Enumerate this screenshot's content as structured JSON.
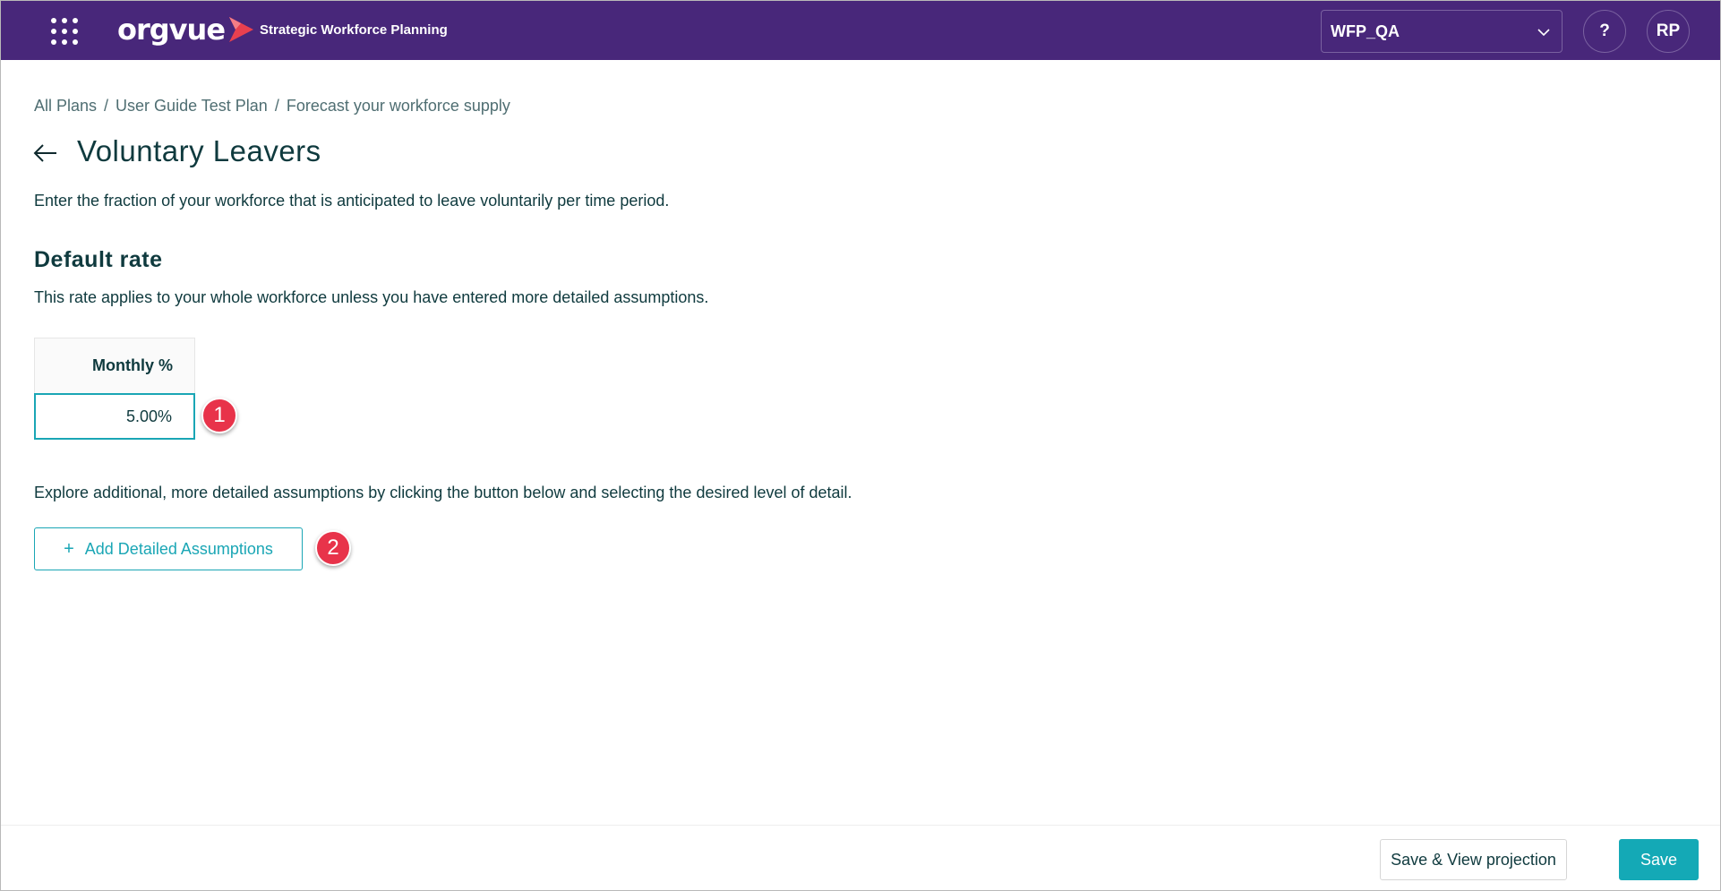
{
  "header": {
    "logo_text": "orgvue",
    "product_name": "Strategic Workforce Planning",
    "tenant_value": "WFP_QA",
    "help_label": "?",
    "avatar_initials": "RP",
    "brand_color": "#48277a",
    "logo_accent_color": "#e8404f"
  },
  "breadcrumb": {
    "items": [
      "All Plans",
      "User Guide Test Plan",
      "Forecast your workforce supply"
    ],
    "separator": "/"
  },
  "page": {
    "title": "Voluntary Leavers",
    "description": "Enter the fraction of your workforce that is anticipated to leave voluntarily per time period."
  },
  "default_rate": {
    "title": "Default rate",
    "description": "This rate applies to your whole workforce unless you have entered more detailed assumptions.",
    "column_header": "Monthly %",
    "value": "5.00%"
  },
  "detailed": {
    "explore_text": "Explore additional, more detailed assumptions by clicking the button below and selecting the desired level of detail.",
    "add_button_label": "Add Detailed Assumptions",
    "add_button_icon": "plus-icon"
  },
  "annotations": {
    "marker_1": "1",
    "marker_2": "2",
    "marker_color": "#e8334a"
  },
  "footer": {
    "save_view_label": "Save & View projection",
    "save_label": "Save",
    "accent_color": "#14a9b6"
  }
}
